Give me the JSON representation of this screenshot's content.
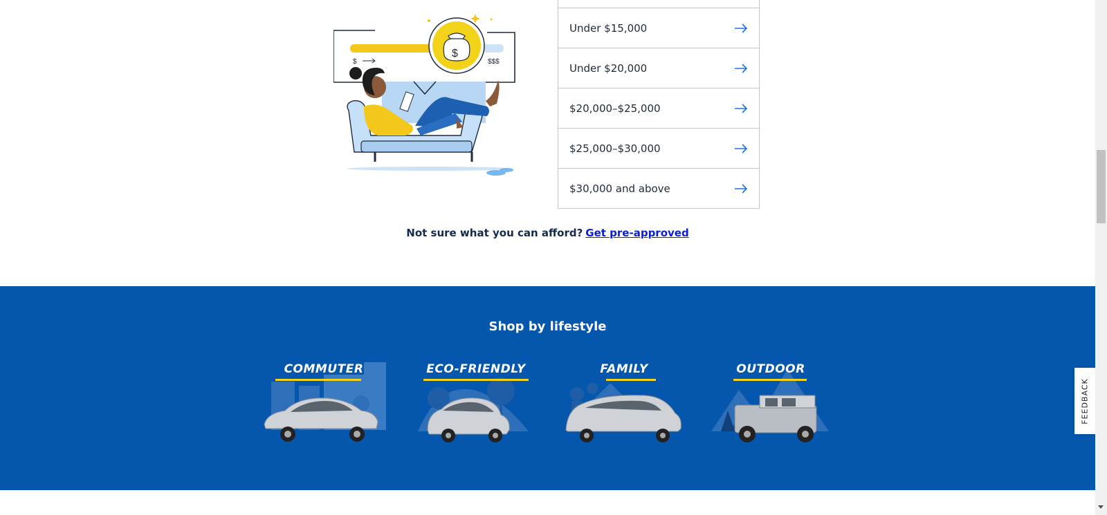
{
  "price_list": {
    "items": [
      {
        "label": "Under $15,000"
      },
      {
        "label": "Under $20,000"
      },
      {
        "label": "$20,000–$25,000"
      },
      {
        "label": "$25,000–$30,000"
      },
      {
        "label": "$30,000 and above"
      }
    ]
  },
  "illustration": {
    "slider_low_label": "$",
    "slider_high_label": "$$$",
    "bag_symbol": "$"
  },
  "afford": {
    "prompt": "Not sure what you can afford?",
    "link": "Get pre-approved"
  },
  "lifestyle": {
    "title": "Shop by lifestyle",
    "tiles": [
      {
        "label": "COMMUTER"
      },
      {
        "label": "ECO-FRIENDLY"
      },
      {
        "label": "FAMILY"
      },
      {
        "label": "OUTDOOR"
      }
    ]
  },
  "feedback": {
    "label": "FEEDBACK"
  },
  "colors": {
    "brand_blue": "#0457ac",
    "accent_yellow": "#f3d21a",
    "link_blue": "#0a1fd1",
    "arrow_blue": "#1a73e8"
  }
}
